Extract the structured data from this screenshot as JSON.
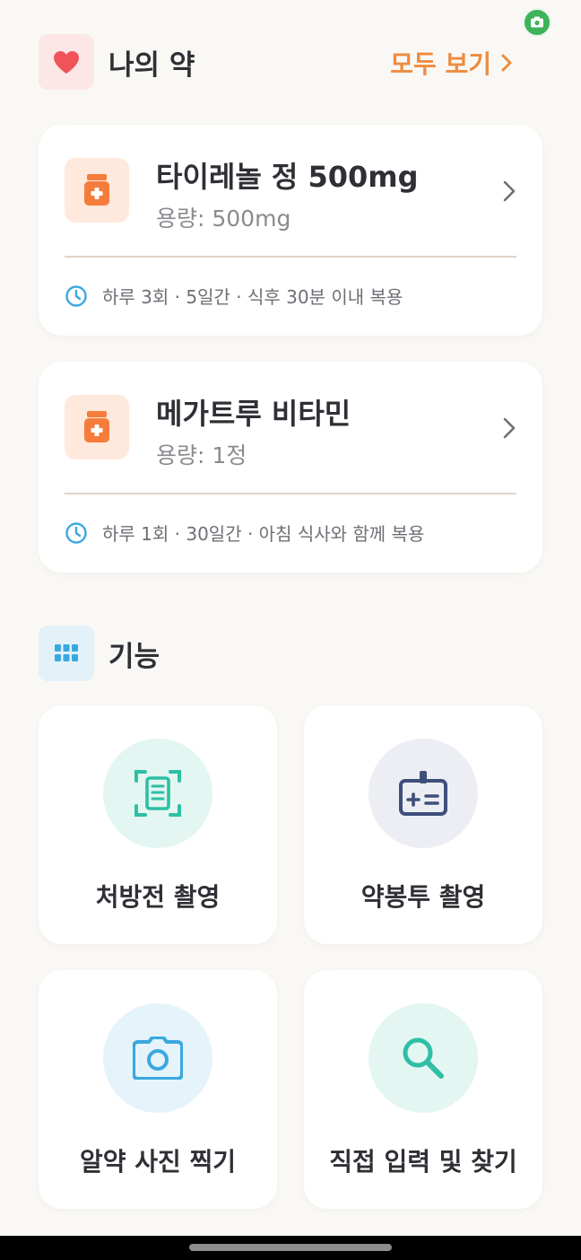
{
  "header": {
    "title": "나의 약",
    "see_all_label": "모두 보기"
  },
  "medications": [
    {
      "name": "타이레놀 정 500mg",
      "dose": "용량: 500mg",
      "schedule": "하루 3회 · 5일간 · 식후 30분 이내 복용"
    },
    {
      "name": "메가트루 비타민",
      "dose": "용량: 1정",
      "schedule": "하루 1회 · 30일간 · 아침 식사와 함께 복용"
    }
  ],
  "features": {
    "title": "기능",
    "items": [
      {
        "label": "처방전 촬영",
        "icon": "prescription-scan-icon"
      },
      {
        "label": "약봉투 촬영",
        "icon": "medicine-bag-icon"
      },
      {
        "label": "알약 사진 찍기",
        "icon": "camera-icon"
      },
      {
        "label": "직접 입력 및 찾기",
        "icon": "search-icon"
      }
    ]
  },
  "colors": {
    "background": "#faf8f5",
    "accent_orange": "#ee8b3e",
    "heart_red": "#f0545a",
    "teal": "#2ebfa5",
    "navy": "#3e4f7a",
    "sky_blue": "#3aa8e0"
  }
}
